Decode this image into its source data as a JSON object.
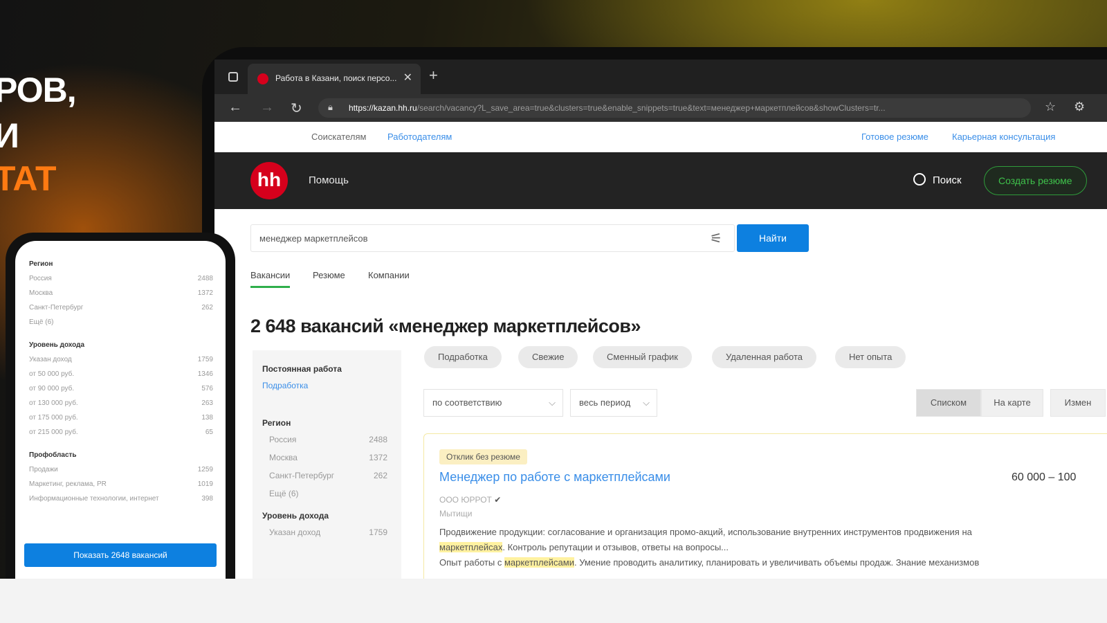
{
  "headline": {
    "line1": "РОВ,",
    "line2": "И",
    "line3": "ТАТ"
  },
  "browser": {
    "tab_title": "Работа в Казани, поиск персо...",
    "new_tab": "+",
    "url_domain": "https://kazan.hh.ru",
    "url_path": "/search/vacancy?L_save_area=true&clusters=true&enable_snippets=true&text=менеджер+маркетплейсов&showClusters=tr...",
    "icons": {
      "back": "back-icon",
      "forward": "forward-icon",
      "reload": "reload-icon",
      "lock": "lock-icon"
    }
  },
  "topnav": {
    "seekers": "Соискателям",
    "employers": "Работодателям",
    "ready_resume": "Готовое резюме",
    "career": "Карьерная консультация"
  },
  "header": {
    "logo": "hh",
    "help": "Помощь",
    "search": "Поиск",
    "create_resume": "Создать резюме"
  },
  "search": {
    "query": "менеджер маркетплейсов",
    "find_button": "Найти",
    "tabs": [
      "Вакансии",
      "Резюме",
      "Компании"
    ]
  },
  "results": {
    "title": "2 648 вакансий «менеджер маркетплейсов»"
  },
  "sidebar": {
    "employment_heading": "Постоянная работа",
    "part_time": "Подработка",
    "region_heading": "Регион",
    "regions": [
      {
        "name": "Россия",
        "count": "2488"
      },
      {
        "name": "Москва",
        "count": "1372"
      },
      {
        "name": "Санкт-Петербург",
        "count": "262"
      },
      {
        "name": "Ещё (6)",
        "count": ""
      }
    ],
    "income_heading": "Уровень дохода",
    "income": [
      {
        "name": "Указан доход",
        "count": "1759"
      }
    ]
  },
  "chips": [
    "Подработка",
    "Свежие",
    "Сменный график",
    "Удаленная работа",
    "Нет опыта"
  ],
  "sort": {
    "order": "по соответствию",
    "period": "весь период",
    "views": [
      "Списком",
      "На карте",
      "Измен"
    ]
  },
  "vacancy": {
    "badge": "Отклик без резюме",
    "title": "Менеджер по работе с маркетплейсами",
    "salary": "60 000 – 100",
    "company": "ООО ЮРРОТ",
    "city": "Мытищи",
    "desc1": "Продвижение продукции: согласование и организация промо-акций, использование внутренних инструментов продвижения на",
    "desc2_mark": "маркетплейсах",
    "desc2_rest": ". Контроль репутации и отзывов, ответы на вопросы...",
    "desc3_start": "Опыт работы с ",
    "desc3_mark": "маркетплейсами",
    "desc3_rest": ". Умение проводить аналитику, планировать и увеличивать объемы продаж. Знание механизмов"
  },
  "phone": {
    "region_heading": "Регион",
    "regions": [
      {
        "name": "Россия",
        "count": "2488"
      },
      {
        "name": "Москва",
        "count": "1372"
      },
      {
        "name": "Санкт-Петербург",
        "count": "262"
      },
      {
        "name": "Ещё (6)",
        "count": ""
      }
    ],
    "income_heading": "Уровень дохода",
    "income": [
      {
        "name": "Указан доход",
        "count": "1759"
      },
      {
        "name": "от 50 000 руб.",
        "count": "1346"
      },
      {
        "name": "от 90 000 руб.",
        "count": "576"
      },
      {
        "name": "от 130 000 руб.",
        "count": "263"
      },
      {
        "name": "от 175 000 руб.",
        "count": "138"
      },
      {
        "name": "от 215 000 руб.",
        "count": "65"
      }
    ],
    "prof_heading": "Профобласть",
    "prof": [
      {
        "name": "Продажи",
        "count": "1259"
      },
      {
        "name": "Маркетинг, реклама, PR",
        "count": "1019"
      },
      {
        "name": "Информационные технологии, интернет",
        "count": "398"
      }
    ],
    "show_button": "Показать 2648 вакансий"
  }
}
